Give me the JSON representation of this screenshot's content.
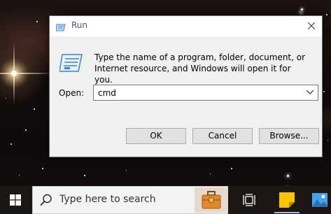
{
  "dialog": {
    "title": "Run",
    "description": "Type the name of a program, folder, document, or Internet resource, and Windows will open it for you.",
    "open_label": "Open:",
    "open_value": "cmd",
    "ok_label": "OK",
    "cancel_label": "Cancel",
    "browse_label": "Browse...",
    "close_icon": "close-icon",
    "app_icon": "run-icon"
  },
  "taskbar": {
    "start_icon": "windows-logo-icon",
    "search_placeholder": "Type here to search",
    "search_icon": "search-icon",
    "pinned": [
      "briefcase-icon",
      "task-view-icon",
      "sticky-notes-icon",
      "photos-icon"
    ]
  },
  "colors": {
    "dialog_bg": "#f0f0f0",
    "button_bg": "#e1e1e1",
    "button_border": "#adadad",
    "taskbar_bg": "#1c1614",
    "accent_blue": "#3c84c4",
    "sticky_yellow": "#f7c500",
    "briefcase_orange": "#e08a2c"
  }
}
